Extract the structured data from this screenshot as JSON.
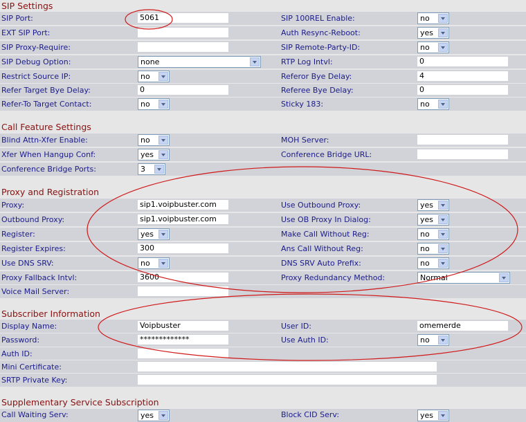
{
  "sections": {
    "sip": "SIP Settings",
    "call": "Call Feature Settings",
    "proxy": "Proxy and Registration",
    "subscriber": "Subscriber Information",
    "supp": "Supplementary Service Subscription"
  },
  "sip": {
    "sip_port": {
      "label": "SIP Port:",
      "value": "5061"
    },
    "sip_100rel": {
      "label": "SIP 100REL Enable:",
      "value": "no"
    },
    "ext_sip_port": {
      "label": "EXT SIP Port:",
      "value": ""
    },
    "auth_resync": {
      "label": "Auth Resync-Reboot:",
      "value": "yes"
    },
    "proxy_require": {
      "label": "SIP Proxy-Require:",
      "value": ""
    },
    "remote_party": {
      "label": "SIP Remote-Party-ID:",
      "value": "no"
    },
    "debug_option": {
      "label": "SIP Debug Option:",
      "value": "none"
    },
    "rtp_log": {
      "label": "RTP Log Intvl:",
      "value": "0"
    },
    "restrict_ip": {
      "label": "Restrict Source IP:",
      "value": "no"
    },
    "referor_bye": {
      "label": "Referor Bye Delay:",
      "value": "4"
    },
    "refer_target_bye": {
      "label": "Refer Target Bye Delay:",
      "value": "0"
    },
    "referee_bye": {
      "label": "Referee Bye Delay:",
      "value": "0"
    },
    "refer_to_contact": {
      "label": "Refer-To Target Contact:",
      "value": "no"
    },
    "sticky_183": {
      "label": "Sticky 183:",
      "value": "no"
    }
  },
  "call": {
    "blind_xfer": {
      "label": "Blind Attn-Xfer Enable:",
      "value": "no"
    },
    "moh_server": {
      "label": "MOH Server:",
      "value": ""
    },
    "xfer_hangup": {
      "label": "Xfer When Hangup Conf:",
      "value": "yes"
    },
    "conf_url": {
      "label": "Conference Bridge URL:",
      "value": ""
    },
    "conf_ports": {
      "label": "Conference Bridge Ports:",
      "value": "3"
    }
  },
  "proxy": {
    "proxy": {
      "label": "Proxy:",
      "value": "sip1.voipbuster.com"
    },
    "use_outbound": {
      "label": "Use Outbound Proxy:",
      "value": "yes"
    },
    "outbound": {
      "label": "Outbound Proxy:",
      "value": "sip1.voipbuster.com"
    },
    "use_ob_dialog": {
      "label": "Use OB Proxy In Dialog:",
      "value": "yes"
    },
    "register": {
      "label": "Register:",
      "value": "yes"
    },
    "call_without_reg": {
      "label": "Make Call Without Reg:",
      "value": "no"
    },
    "reg_expires": {
      "label": "Register Expires:",
      "value": "300"
    },
    "ans_without_reg": {
      "label": "Ans Call Without Reg:",
      "value": "no"
    },
    "dns_srv": {
      "label": "Use DNS SRV:",
      "value": "no"
    },
    "dns_prefix": {
      "label": "DNS SRV Auto Prefix:",
      "value": "no"
    },
    "fallback": {
      "label": "Proxy Fallback Intvl:",
      "value": "3600"
    },
    "redundancy": {
      "label": "Proxy Redundancy Method:",
      "value": "Normal"
    },
    "voicemail": {
      "label": "Voice Mail Server:",
      "value": ""
    }
  },
  "subscriber": {
    "display_name": {
      "label": "Display Name:",
      "value": "Voipbuster"
    },
    "user_id": {
      "label": "User ID:",
      "value": "omemerde"
    },
    "password": {
      "label": "Password:",
      "value": "*************"
    },
    "use_auth_id": {
      "label": "Use Auth ID:",
      "value": "no"
    },
    "auth_id": {
      "label": "Auth ID:",
      "value": ""
    },
    "mini_cert": {
      "label": "Mini Certificate:",
      "value": ""
    },
    "srtp_key": {
      "label": "SRTP Private Key:",
      "value": ""
    }
  },
  "supp": {
    "partial_left": {
      "label": "Call Waiting Serv:",
      "value": "yes"
    },
    "partial_right": {
      "label": "Block CID Serv:",
      "value": "yes"
    }
  },
  "colors": {
    "row_bg": "#d2d3d8",
    "label": "#1a1a8c",
    "section": "#8b1010",
    "annotation": "#d01818"
  }
}
